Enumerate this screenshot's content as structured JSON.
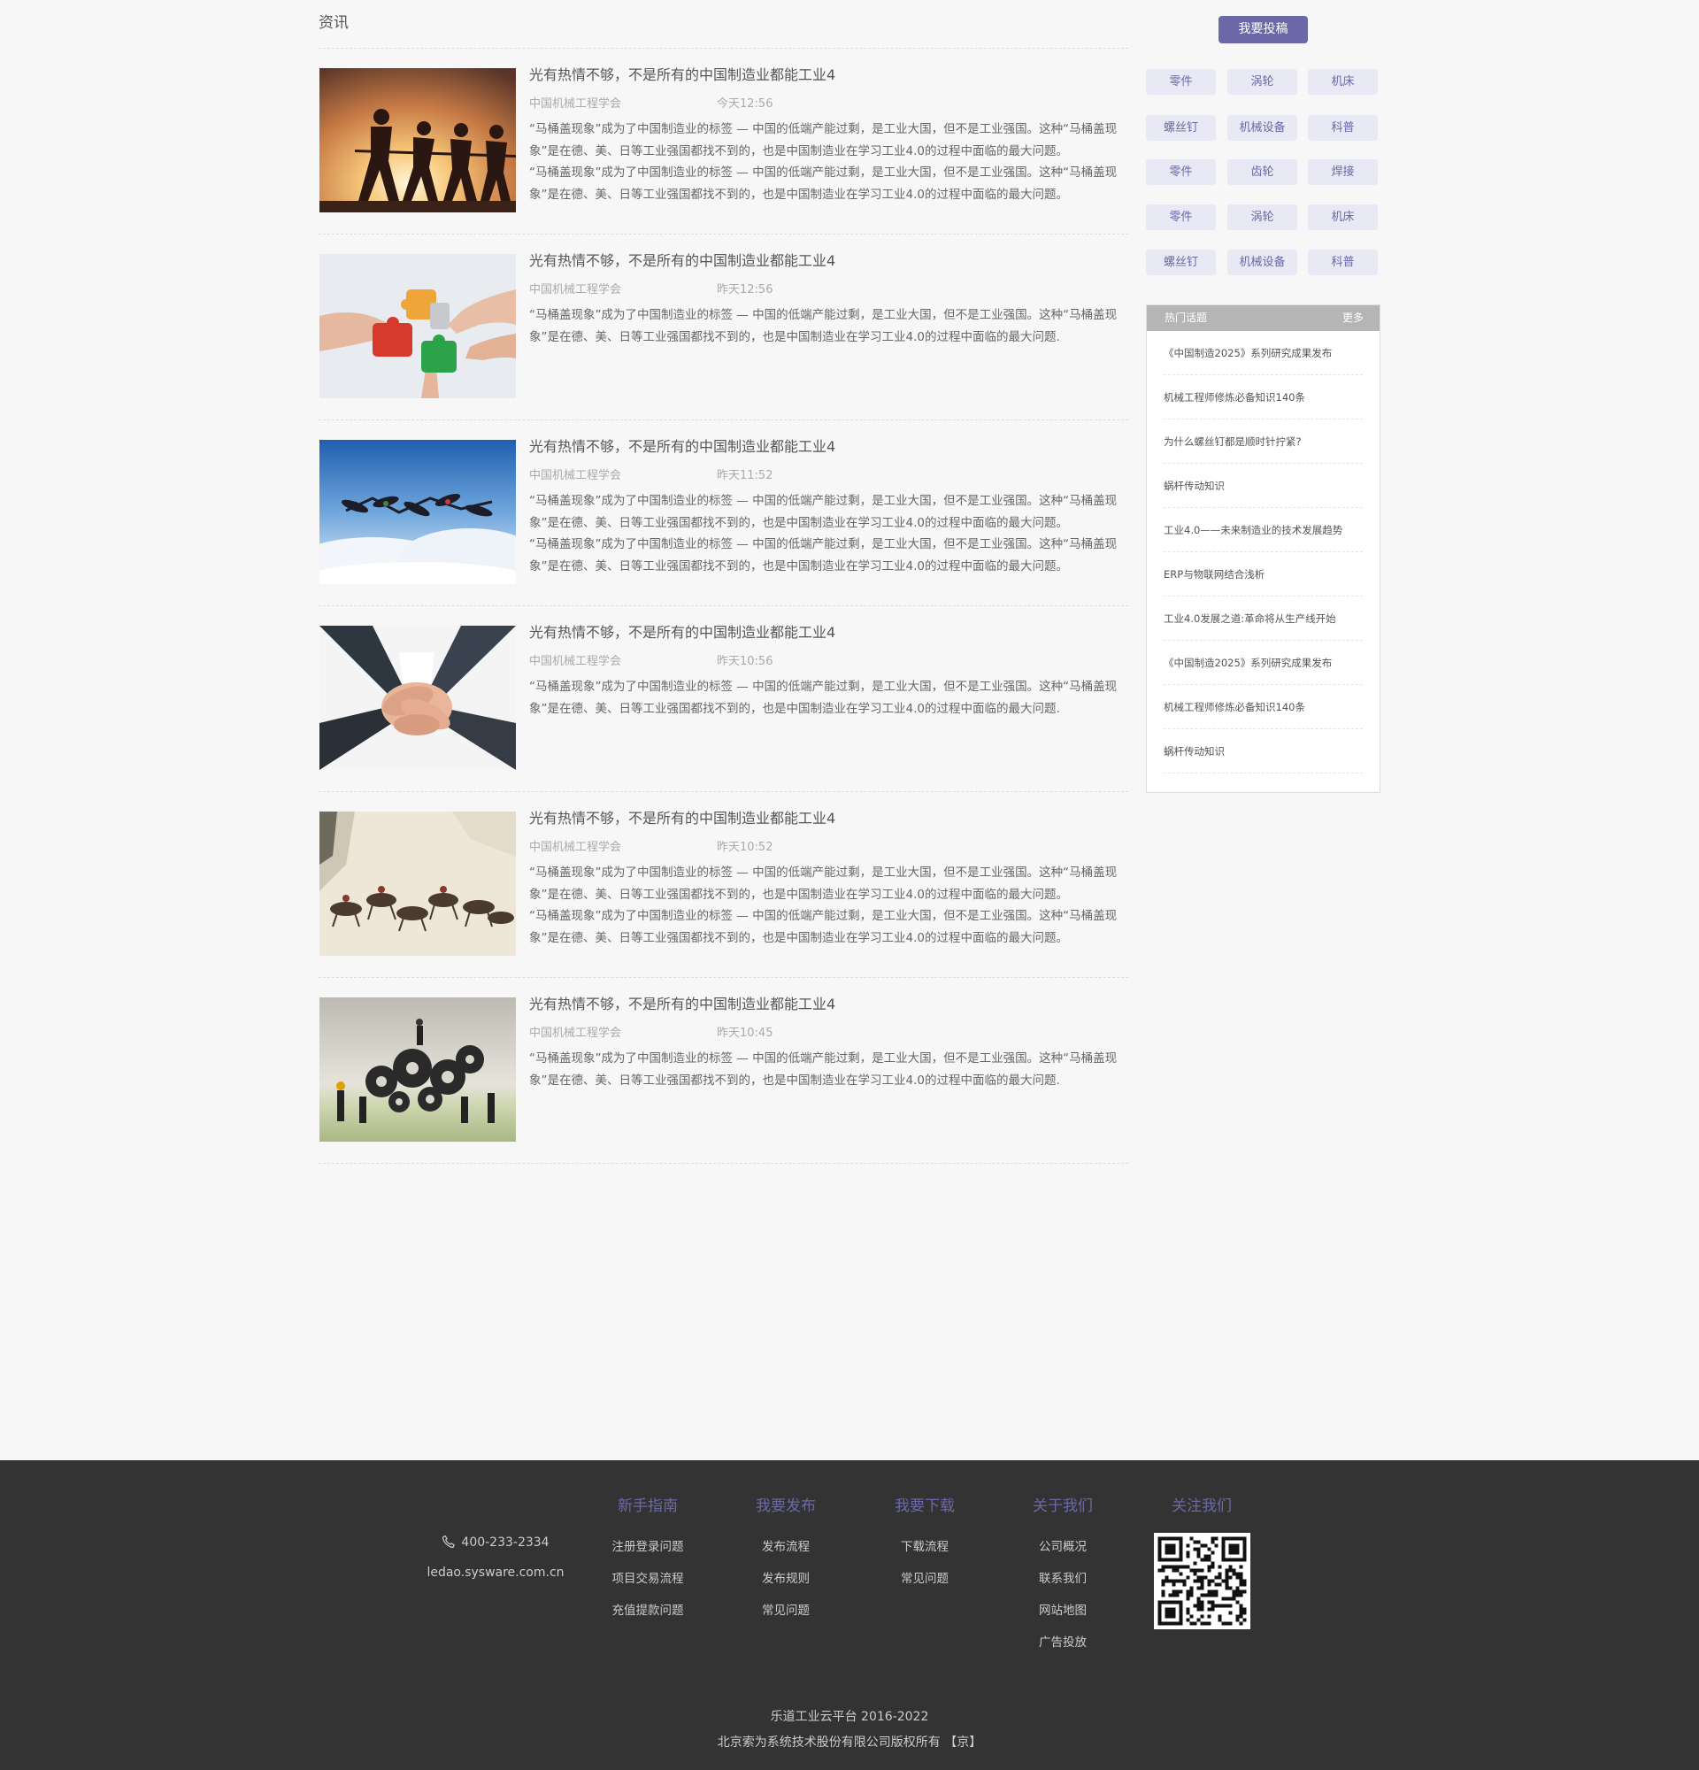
{
  "section_title": "资讯",
  "articles": [
    {
      "title": "光有热情不够，不是所有的中国制造业都能工业4",
      "source": "中国机械工程学会",
      "time": "今天12:56",
      "paras": [
        "“马桶盖现象”成为了中国制造业的标签 — 中国的低端产能过剩，是工业大国，但不是工业强国。这种“马桶盖现象”是在德、美、日等工业强国都找不到的，也是中国制造业在学习工业4.0的过程中面临的最大问题。",
        "“马桶盖现象”成为了中国制造业的标签 — 中国的低端产能过剩，是工业大国，但不是工业强国。这种“马桶盖现象”是在德、美、日等工业强国都找不到的，也是中国制造业在学习工业4.0的过程中面临的最大问题。"
      ]
    },
    {
      "title": "光有热情不够，不是所有的中国制造业都能工业4",
      "source": "中国机械工程学会",
      "time": "昨天12:56",
      "paras": [
        "“马桶盖现象”成为了中国制造业的标签 — 中国的低端产能过剩，是工业大国，但不是工业强国。这种“马桶盖现象”是在德、美、日等工业强国都找不到的，也是中国制造业在学习工业4.0的过程中面临的最大问题."
      ]
    },
    {
      "title": "光有热情不够，不是所有的中国制造业都能工业4",
      "source": "中国机械工程学会",
      "time": "昨天11:52",
      "paras": [
        "“马桶盖现象”成为了中国制造业的标签 — 中国的低端产能过剩，是工业大国，但不是工业强国。这种“马桶盖现象”是在德、美、日等工业强国都找不到的，也是中国制造业在学习工业4.0的过程中面临的最大问题。",
        "“马桶盖现象”成为了中国制造业的标签 — 中国的低端产能过剩，是工业大国，但不是工业强国。这种“马桶盖现象”是在德、美、日等工业强国都找不到的，也是中国制造业在学习工业4.0的过程中面临的最大问题。"
      ]
    },
    {
      "title": "光有热情不够，不是所有的中国制造业都能工业4",
      "source": "中国机械工程学会",
      "time": "昨天10:56",
      "paras": [
        "“马桶盖现象”成为了中国制造业的标签 — 中国的低端产能过剩，是工业大国，但不是工业强国。这种“马桶盖现象”是在德、美、日等工业强国都找不到的，也是中国制造业在学习工业4.0的过程中面临的最大问题."
      ]
    },
    {
      "title": "光有热情不够，不是所有的中国制造业都能工业4",
      "source": "中国机械工程学会",
      "time": "昨天10:52",
      "paras": [
        "“马桶盖现象”成为了中国制造业的标签 — 中国的低端产能过剩，是工业大国，但不是工业强国。这种“马桶盖现象”是在德、美、日等工业强国都找不到的，也是中国制造业在学习工业4.0的过程中面临的最大问题。",
        "“马桶盖现象”成为了中国制造业的标签 — 中国的低端产能过剩，是工业大国，但不是工业强国。这种“马桶盖现象”是在德、美、日等工业强国都找不到的，也是中国制造业在学习工业4.0的过程中面临的最大问题。"
      ]
    },
    {
      "title": "光有热情不够，不是所有的中国制造业都能工业4",
      "source": "中国机械工程学会",
      "time": "昨天10:45",
      "paras": [
        "“马桶盖现象”成为了中国制造业的标签 — 中国的低端产能过剩，是工业大国，但不是工业强国。这种“马桶盖现象”是在德、美、日等工业强国都找不到的，也是中国制造业在学习工业4.0的过程中面临的最大问题."
      ]
    }
  ],
  "sidebar": {
    "submit_label": "我要投稿",
    "tags": [
      "零件",
      "涡轮",
      "机床",
      "螺丝钉",
      "机械设备",
      "科普",
      "零件",
      "齿轮",
      "焊接",
      "零件",
      "涡轮",
      "机床",
      "螺丝钉",
      "机械设备",
      "科普"
    ],
    "hot": {
      "title": "热门话题",
      "more": "更多",
      "items": [
        "《中国制造2025》系列研究成果发布",
        "机械工程师修炼必备知识140条",
        "为什么螺丝钉都是顺时针拧紧?",
        "蜗杆传动知识",
        "工业4.0——未来制造业的技术发展趋势",
        "ERP与物联网结合浅析",
        "工业4.0发展之道:革命将从生产线开始",
        "《中国制造2025》系列研究成果发布",
        "机械工程师修炼必备知识140条",
        "蜗杆传动知识"
      ]
    }
  },
  "footer": {
    "phone": "400-233-2334",
    "site": "ledao.sysware.com.cn",
    "columns": [
      {
        "title": "新手指南",
        "links": [
          "注册登录问题",
          "项目交易流程",
          "充值提款问题"
        ]
      },
      {
        "title": "我要发布",
        "links": [
          "发布流程",
          "发布规则",
          "常见问题"
        ]
      },
      {
        "title": "我要下载",
        "links": [
          "下载流程",
          "常见问题"
        ]
      },
      {
        "title": "关于我们",
        "links": [
          "公司概况",
          "联系我们",
          "网站地图",
          "广告投放"
        ]
      }
    ],
    "follow_title": "关注我们",
    "copyright": "乐道工业云平台 2016-2022",
    "company": "北京索为系统技术股份有限公司版权所有 【京】"
  },
  "colors": {
    "accent": "#6b68a8",
    "tag_bg": "#e9e8f5",
    "footer_bg": "#333333",
    "page_bg": "#f7f7f7"
  }
}
